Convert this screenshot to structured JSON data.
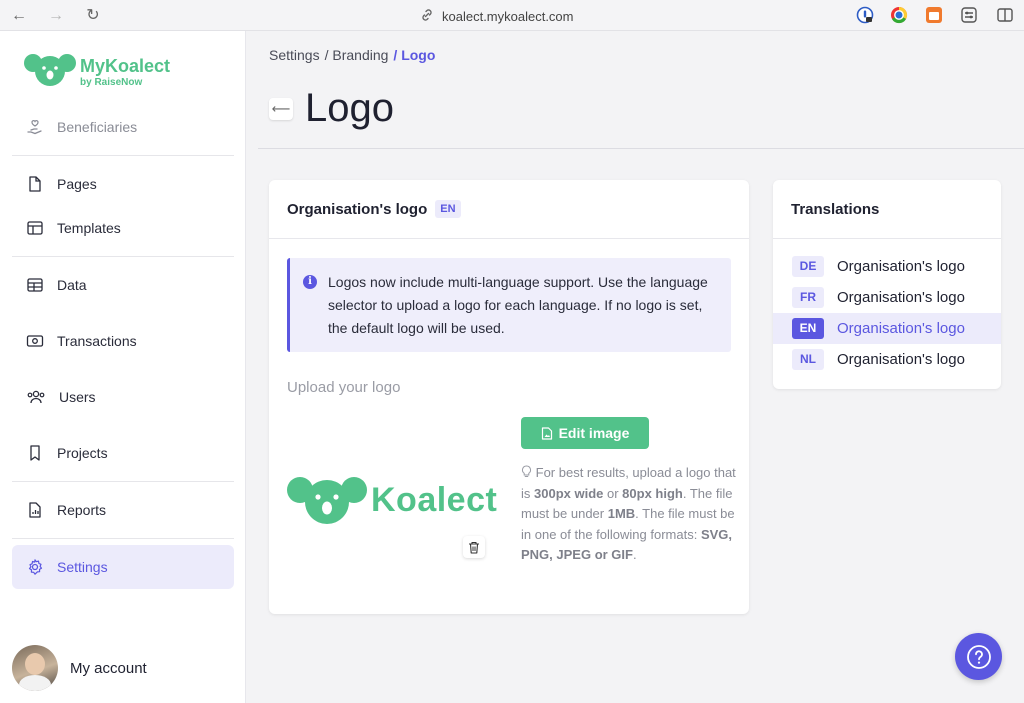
{
  "browser": {
    "url": "koalect.mykoalect.com",
    "icons": [
      "back-arrow-icon",
      "forward-arrow-icon",
      "reload-icon",
      "link-icon"
    ]
  },
  "brand": {
    "name": "MyKoalect",
    "sub": "by RaiseNow",
    "color": "#52c28a",
    "accent": "#5b57e0"
  },
  "sidebar": {
    "items": [
      {
        "label": "Beneficiaries",
        "icon": "hand-heart-icon"
      },
      {
        "label": "Pages",
        "icon": "file-icon"
      },
      {
        "label": "Templates",
        "icon": "layout-icon"
      },
      {
        "label": "Data",
        "icon": "table-icon"
      },
      {
        "label": "Transactions",
        "icon": "banknote-icon"
      },
      {
        "label": "Users",
        "icon": "users-icon"
      },
      {
        "label": "Projects",
        "icon": "bookmark-icon"
      },
      {
        "label": "Reports",
        "icon": "report-icon"
      },
      {
        "label": "Settings",
        "icon": "gear-icon"
      }
    ],
    "account_label": "My account"
  },
  "breadcrumb": {
    "items": [
      "Settings",
      "/ Branding",
      "/ Logo"
    ]
  },
  "page": {
    "title": "Logo"
  },
  "logo_card": {
    "title": "Organisation's logo",
    "lang": "EN",
    "info_text": "Logos now include multi-language support. Use the language selector to upload a logo for each language. If no logo is set, the default logo will be used.",
    "upload_label": "Upload your logo",
    "preview_text": "Koalect",
    "edit_button": "Edit image",
    "hint": {
      "p1": "For best results, upload a logo that is ",
      "b1": "300px wide",
      "p2": " or ",
      "b2": "80px high",
      "p3": ". The file must be under ",
      "b3": "1MB",
      "p4": ". The file must be in one of the following formats: ",
      "b4": "SVG, PNG, JPEG or GIF",
      "p5": "."
    }
  },
  "translations": {
    "title": "Translations",
    "rows": [
      {
        "code": "DE",
        "label": "Organisation's logo"
      },
      {
        "code": "FR",
        "label": "Organisation's logo"
      },
      {
        "code": "EN",
        "label": "Organisation's logo"
      },
      {
        "code": "NL",
        "label": "Organisation's logo"
      }
    ],
    "active": "EN"
  }
}
